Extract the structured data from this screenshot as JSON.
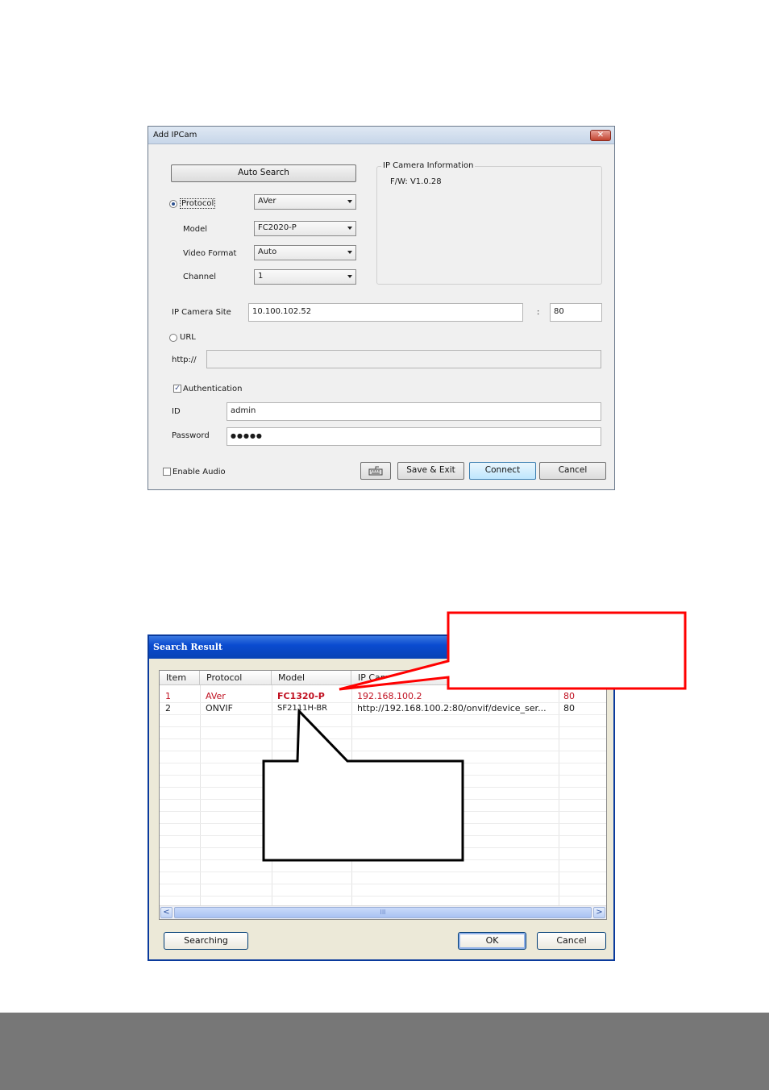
{
  "add_ipcam": {
    "title": "Add IPCam",
    "close": "✕",
    "auto_search": "Auto Search",
    "protocol_label": "Protocol",
    "protocol_value": "AVer",
    "model_label": "Model",
    "model_value": "FC2020-P",
    "video_format_label": "Video Format",
    "video_format_value": "Auto",
    "channel_label": "Channel",
    "channel_value": "1",
    "info_group_label": "IP Camera Information",
    "firmware": "F/W: V1.0.28",
    "ip_site_label": "IP Camera Site",
    "ip_site_value": "10.100.102.52",
    "port_sep": ":",
    "port_value": "80",
    "url_label": "URL",
    "http_label": "http://",
    "url_value": "",
    "auth_label": "Authentication",
    "auth_checked": true,
    "id_label": "ID",
    "id_value": "admin",
    "password_label": "Password",
    "password_value": "●●●●●",
    "enable_audio_label": "Enable Audio",
    "save_exit": "Save & Exit",
    "connect": "Connect",
    "cancel": "Cancel"
  },
  "search_result": {
    "title": "Search Result",
    "columns": [
      "Item",
      "Protocol",
      "Model",
      "IP Camera Site",
      ""
    ],
    "rows": [
      {
        "item": "1",
        "protocol": "AVer",
        "model": "FC1320-P",
        "site": "192.168.100.2",
        "port": "80",
        "highlight": true
      },
      {
        "item": "2",
        "protocol": "ONVIF",
        "model": "SF2111H-BR",
        "site": "http://192.168.100.2:80/onvif/device_ser...",
        "port": "80",
        "highlight": false
      }
    ],
    "scroll_left": "<",
    "scroll_right": ">",
    "scroll_grip": "III",
    "searching": "Searching",
    "ok": "OK",
    "cancel": "Cancel"
  },
  "colors": {
    "highlight_row": "#c01020",
    "callout_red": "#ff0000",
    "footer_band": "#777777"
  }
}
